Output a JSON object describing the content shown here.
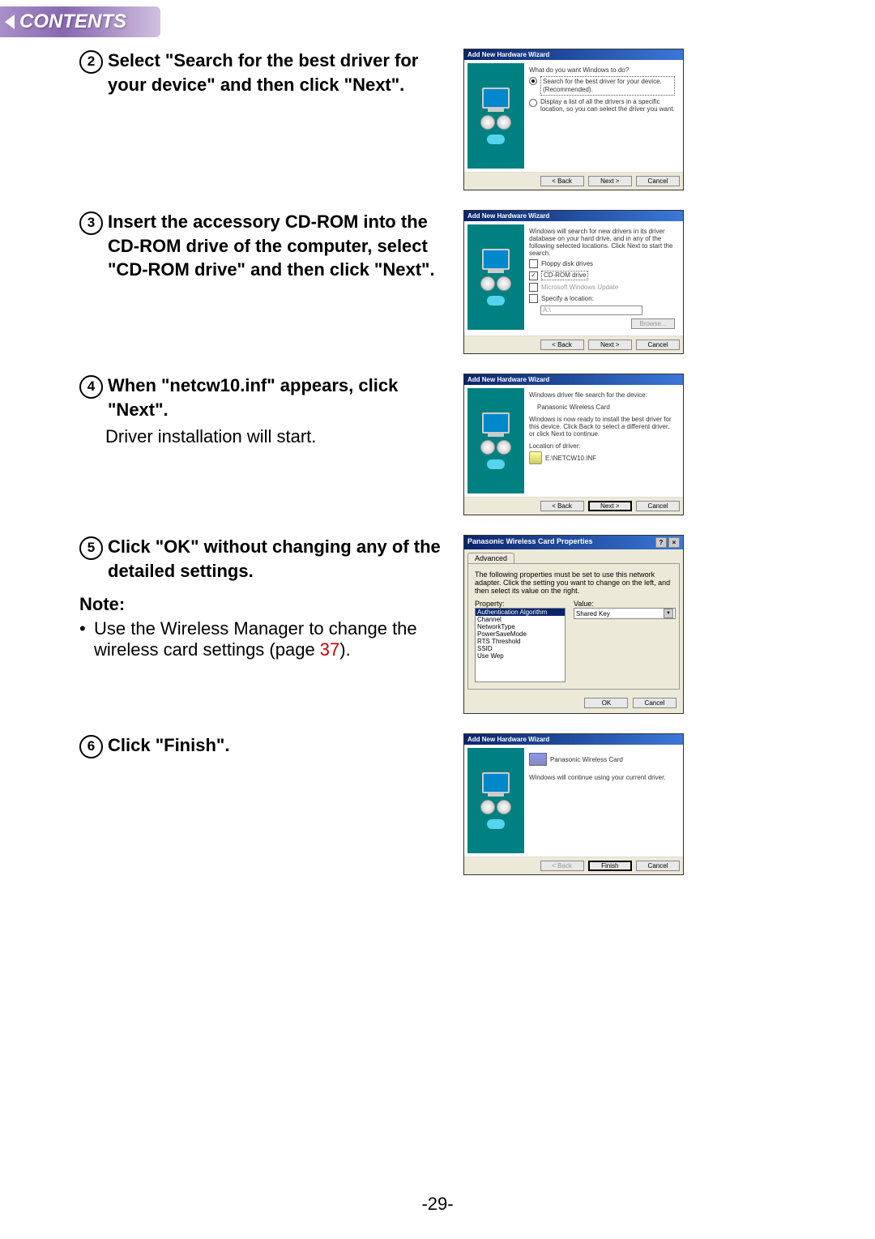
{
  "header": {
    "contents_label": "CONTENTS"
  },
  "steps": {
    "s2": {
      "num": "2",
      "title": "Select \"Search for the best driver for your device\" and then click \"Next\"."
    },
    "s3": {
      "num": "3",
      "title": "Insert the accessory CD-ROM into the CD-ROM drive of the computer, select \"CD-ROM drive\" and then click \"Next\"."
    },
    "s4": {
      "num": "4",
      "title": "When \"netcw10.inf\" appears, click \"Next\".",
      "body": "Driver installation will start."
    },
    "s5": {
      "num": "5",
      "title": "Click \"OK\" without changing any of the detailed settings.",
      "note_label": "Note:",
      "note_body_prefix": "Use the Wireless Manager to change the wireless card settings (page ",
      "note_page": "37",
      "note_body_suffix": ")."
    },
    "s6": {
      "num": "6",
      "title": "Click \"Finish\"."
    }
  },
  "wizard": {
    "title": "Add New Hardware Wizard",
    "btn_back": "< Back",
    "btn_next": "Next >",
    "btn_cancel": "Cancel",
    "btn_finish": "Finish",
    "btn_browse": "Browse..."
  },
  "w2": {
    "prompt": "What do you want Windows to do?",
    "opt1": "Search for the best driver for your device. (Recommended).",
    "opt2": "Display a list of all the drivers in a specific location, so you can select the driver you want."
  },
  "w3": {
    "intro": "Windows will search for new drivers in its driver database on your hard drive, and in any of the following selected locations. Click Next to start the search.",
    "chk_floppy": "Floppy disk drives",
    "chk_cdrom": "CD-ROM drive",
    "chk_update": "Microsoft Windows Update",
    "chk_loc": "Specify a location:",
    "loc_value": "A:\\"
  },
  "w4": {
    "line1": "Windows driver file search for the device:",
    "device": "Panasonic Wireless Card",
    "line2": "Windows is now ready to install the best driver for this device. Click Back to select a different driver, or click Next to continue.",
    "loc_label": "Location of driver:",
    "loc_value": "E:\\NETCW10.INF"
  },
  "w6": {
    "device": "Panasonic Wireless Card",
    "msg": "Windows will continue using your current driver."
  },
  "props": {
    "title": "Panasonic Wireless Card Properties",
    "tab": "Advanced",
    "desc": "The following properties must be set to use this network adapter. Click the setting you want to change on the left, and then select its value on the right.",
    "prop_label": "Property:",
    "val_label": "Value:",
    "items": [
      "Authentication Algorithm",
      "Channel",
      "NetworkType",
      "PowerSaveMode",
      "RTS Threshold",
      "SSID",
      "Use Wep"
    ],
    "value": "Shared Key",
    "btn_ok": "OK",
    "btn_cancel": "Cancel"
  },
  "page_number": "-29-"
}
